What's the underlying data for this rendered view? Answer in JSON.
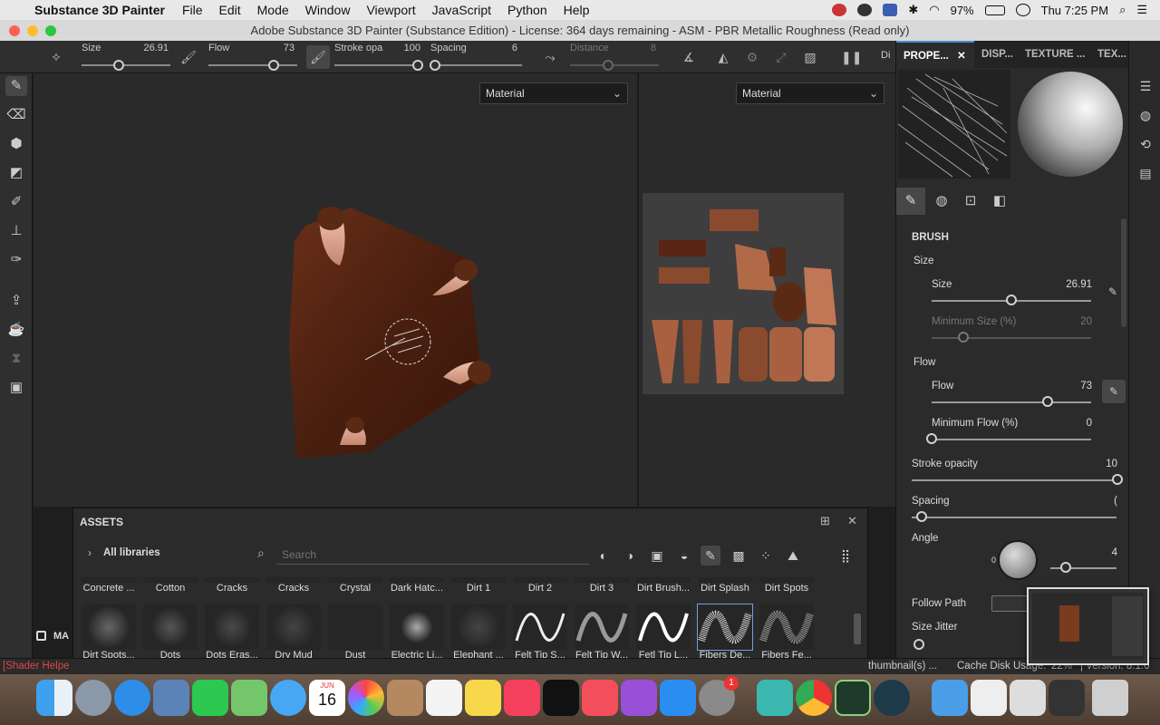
{
  "menubar": {
    "app_name": "Substance 3D Painter",
    "items": [
      "File",
      "Edit",
      "Mode",
      "Window",
      "Viewport",
      "JavaScript",
      "Python",
      "Help"
    ],
    "battery": "97%",
    "clock": "Thu 7:25 PM"
  },
  "window": {
    "title": "Adobe Substance 3D Painter (Substance Edition) - License: 364 days remaining - ASM - PBR Metallic Roughness (Read only)"
  },
  "toolbar": {
    "size_label": "Size",
    "size_value": "26.91",
    "size_level": 0.42,
    "flow_label": "Flow",
    "flow_value": "73",
    "flow_level": 0.73,
    "stroke_label": "Stroke opa",
    "stroke_value": "100",
    "stroke_level": 1.0,
    "spacing_label": "Spacing",
    "spacing_value": "6",
    "spacing_level": 0.02,
    "distance_label": "Distance",
    "distance_value": "8",
    "cut_label": "Di"
  },
  "viewport3d": {
    "channel": "Material"
  },
  "viewport2d": {
    "channel": "Material"
  },
  "right_panel": {
    "tabs": [
      {
        "label": "PROPE...",
        "active": true
      },
      {
        "label": "DISP...",
        "active": false
      },
      {
        "label": "TEXTURE ...",
        "active": false
      },
      {
        "label": "TEX...",
        "active": false
      }
    ],
    "section": "BRUSH",
    "size_group": "Size",
    "size_label": "Size",
    "size_value": "26.91",
    "size_level": 0.5,
    "min_size_label": "Minimum Size (%)",
    "min_size_value": "20",
    "min_size_level": 0.2,
    "flow_group": "Flow",
    "flow_label": "Flow",
    "flow_value": "73",
    "flow_level": 0.73,
    "min_flow_label": "Minimum Flow (%)",
    "min_flow_value": "0",
    "min_flow_level": 0.0,
    "stroke_label": "Stroke opacity",
    "stroke_value": "10",
    "spacing_label": "Spacing",
    "spacing_value": "(",
    "angle_label": "Angle",
    "angle_value": "4",
    "angle_zero": "0",
    "follow_path_label": "Follow Path",
    "size_jitter_label": "Size Jitter"
  },
  "assets": {
    "title": "ASSETS",
    "library": "All libraries",
    "search_placeholder": "Search",
    "row1": [
      "Concrete ...",
      "Cotton",
      "Cracks",
      "Cracks",
      "Crystal",
      "Dark Hatc...",
      "Dirt 1",
      "Dirt 2",
      "Dirt 3",
      "Dirt Brush...",
      "Dirt Splash",
      "Dirt Spots"
    ],
    "row2": [
      "Dirt Spots...",
      "Dots",
      "Dots Eras...",
      "Dry Mud",
      "Dust",
      "Electric Li...",
      "Elephant ...",
      "Felt Tip S...",
      "Felt Tip W...",
      "Fetl Tip L...",
      "Fibers De...",
      "Fibers Fe..."
    ]
  },
  "left_label": "MA",
  "status": {
    "left": "[Shader Helpe",
    "middle": "thumbnail(s) ...",
    "cache": "Cache Disk Usage:",
    "cache_value": "22%",
    "version": "| Version: 8.1.0"
  },
  "dock": {
    "calendar_month": "JUN",
    "calendar_day": "16",
    "badge": "1",
    "apps": [
      "Finder",
      "Launchpad",
      "Safari",
      "Preview",
      "FaceTime",
      "Maps",
      "Messages",
      "Calendar",
      "Photos",
      "Contacts",
      "Reminders",
      "Notes",
      "Music",
      "TV",
      "News",
      "Podcasts",
      "App Store",
      "System Preferences",
      "Substance Mixer",
      "Chrome",
      "Substance Painter",
      "Krita",
      "Folder",
      "Screenshot",
      "Screenshot",
      "Screenshot",
      "Trash"
    ]
  },
  "colors": {
    "accent": "#4a90d9",
    "panel": "#2b2b2b",
    "viewport": "#2a2a2a"
  }
}
